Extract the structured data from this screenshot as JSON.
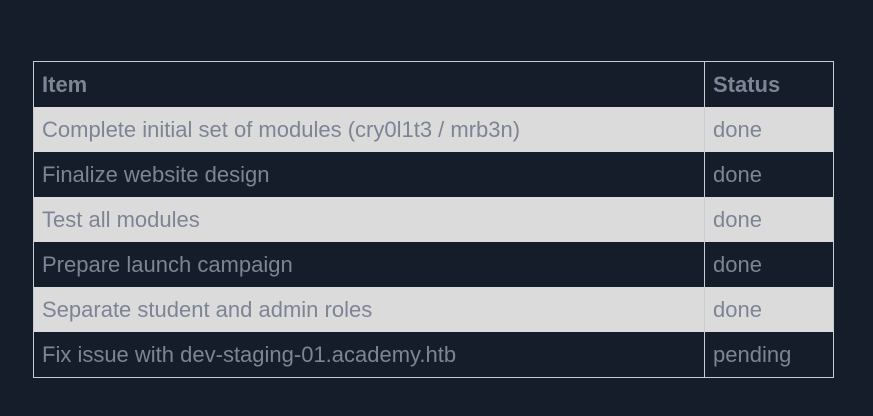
{
  "table": {
    "headers": {
      "item": "Item",
      "status": "Status"
    },
    "rows": [
      {
        "item": "Complete initial set of modules (cry0l1t3 / mrb3n)",
        "status": "done"
      },
      {
        "item": "Finalize website design",
        "status": "done"
      },
      {
        "item": "Test all modules",
        "status": "done"
      },
      {
        "item": "Prepare launch campaign",
        "status": "done"
      },
      {
        "item": "Separate student and admin roles",
        "status": "done"
      },
      {
        "item": "Fix issue with dev-staging-01.academy.htb",
        "status": "pending"
      }
    ]
  },
  "colors": {
    "background": "#151d2b",
    "row_light": "#dbdbdb",
    "text": "#7d8494",
    "border": "#c7ccd3"
  }
}
